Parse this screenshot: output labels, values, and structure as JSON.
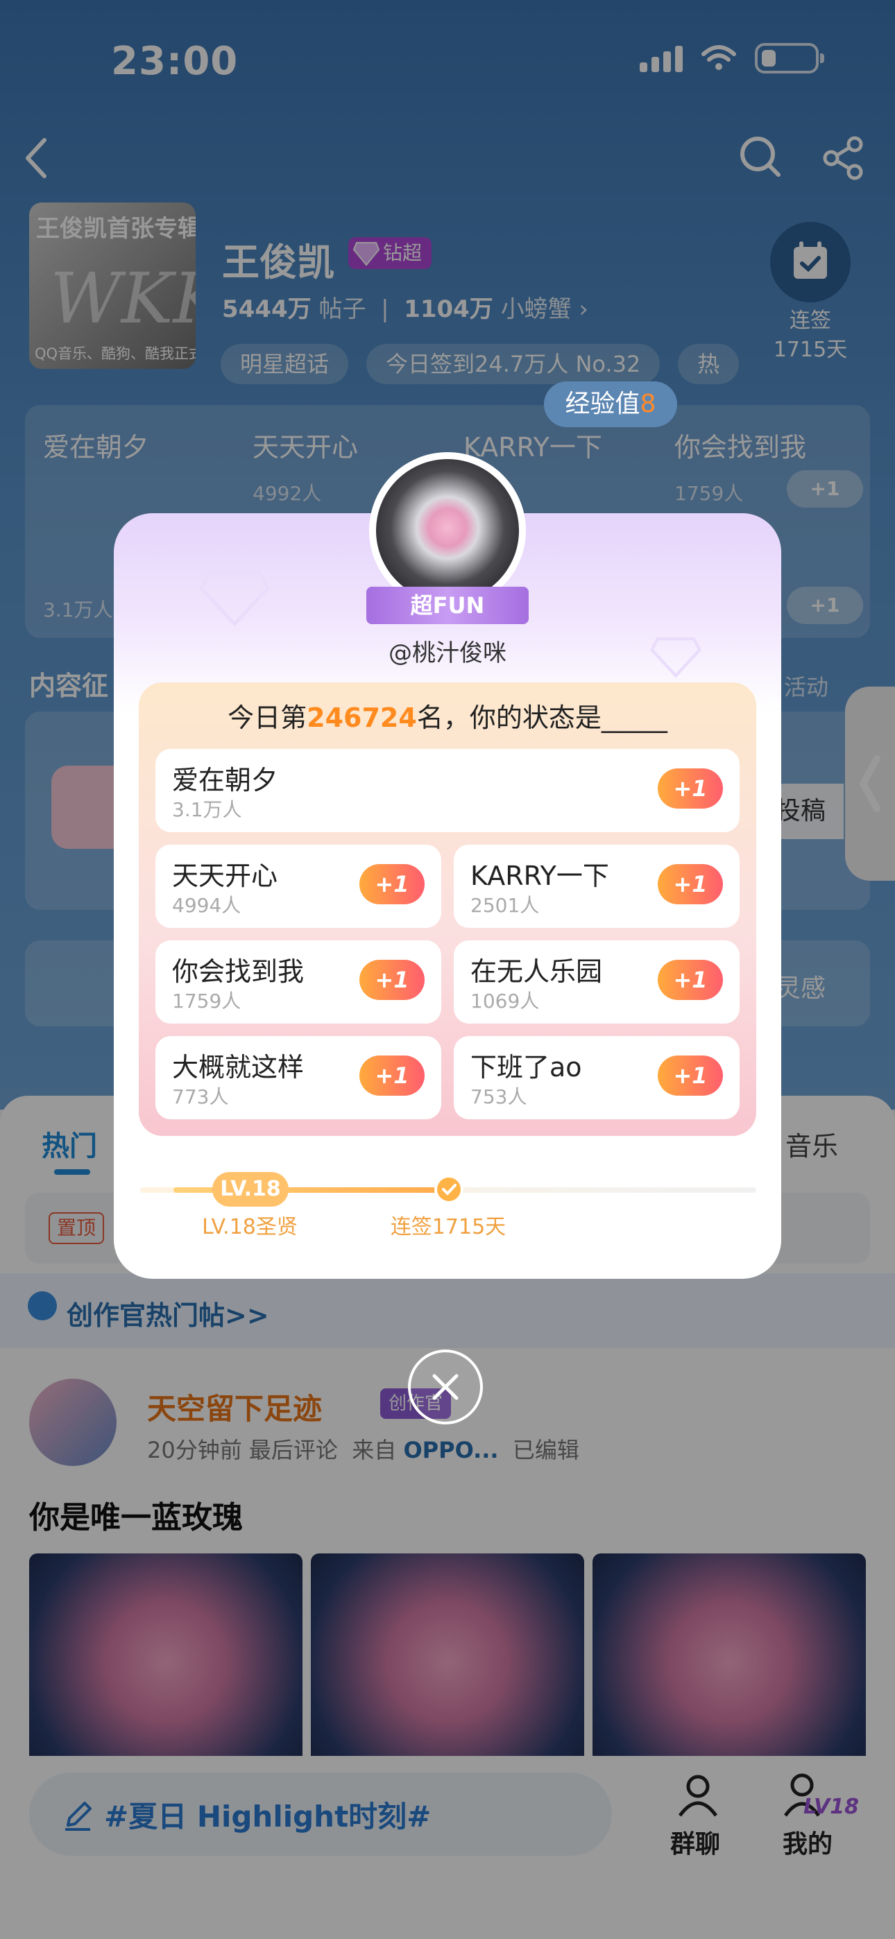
{
  "status_bar": {
    "time": "23:00"
  },
  "header": {
    "back_icon": "chevron-left-icon",
    "search_icon": "search-icon",
    "share_icon": "share-icon"
  },
  "community": {
    "cover_title": "王俊凯首张专辑",
    "cover_mark": "WKK",
    "cover_subtitle": "QQ音乐、酷狗、酷我正式上线",
    "name": "王俊凯",
    "badge": "钻超",
    "posts_num": "5444万",
    "posts_label": "帖子",
    "fans_num": "1104万",
    "fans_label": "小螃蟹",
    "tags": [
      "明星超话",
      "今日签到24.7万人 No.32",
      "热"
    ],
    "checkin_label": "连签",
    "checkin_days": "1715天"
  },
  "bg_cards": [
    {
      "name": "爱在朝夕",
      "count": "3.1万人"
    },
    {
      "name": "天天开心",
      "count": "4992人"
    },
    {
      "name": "KARRY一下",
      "count": ""
    },
    {
      "name": "你会找到我",
      "count": "1759人"
    }
  ],
  "bg_plus": "+1",
  "bg_section_title": "内容征",
  "bg_section_more": "活动",
  "bg_post_button": "投稿",
  "bg_bar_right": "灵感",
  "feed": {
    "tab_hot": "热门",
    "tab_music": "音乐",
    "pinned_tag": "置顶",
    "hot_posts_link": "创作官热门帖>>",
    "post": {
      "author": "天空留下足迹",
      "creator_badge": "创作官",
      "time": "20分钟前",
      "last_comment": "最后评论",
      "source_prefix": "来自",
      "source": "OPPO...",
      "edited": "已编辑",
      "title": "你是唯一蓝玫瑰"
    }
  },
  "bottom_bar": {
    "compose_text": "#夏日 Highlight时刻#",
    "group_chat": "群聊",
    "mine": "我的",
    "mine_level": "LV18"
  },
  "popup": {
    "exp_label": "经验值",
    "exp_value": "8",
    "ribbon": "超FUN",
    "handle": "@桃汁俊咪",
    "q_prefix": "今日第",
    "q_rank": "246724",
    "q_suffix": "名，你的状态是_____",
    "plus_label": "+1",
    "options": [
      {
        "name": "爱在朝夕",
        "count": "3.1万人"
      },
      {
        "name": "天天开心",
        "count": "4994人"
      },
      {
        "name": "KARRY一下",
        "count": "2501人"
      },
      {
        "name": "你会找到我",
        "count": "1759人"
      },
      {
        "name": "在无人乐园",
        "count": "1069人"
      },
      {
        "name": "大概就这样",
        "count": "773人"
      },
      {
        "name": "下班了ao",
        "count": "753人"
      }
    ],
    "level_pill": "LV.18",
    "level_title": "LV.18圣贤",
    "checkin_streak": "连签1715天",
    "close_icon": "close-icon"
  },
  "colors": {
    "accent_blue": "#1f8ad8",
    "rank_orange": "#ff8a1e",
    "plus_gradient_start": "#ffaa3d",
    "plus_gradient_end": "#ff5f6d"
  }
}
